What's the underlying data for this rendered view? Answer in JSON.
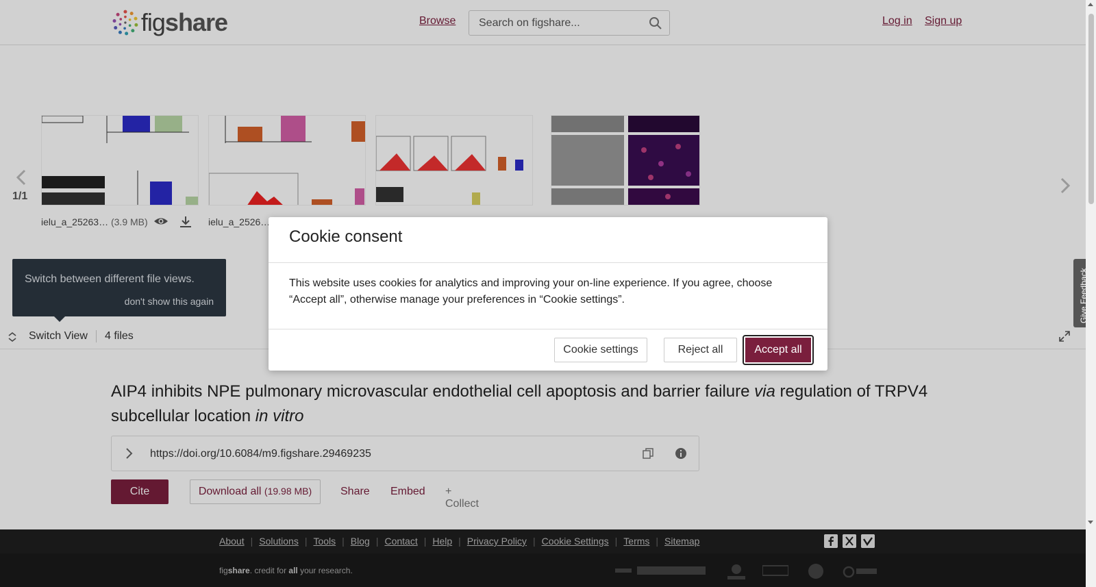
{
  "header": {
    "logo_light": "fig",
    "logo_bold": "share",
    "browse_label": "Browse",
    "search_placeholder": "Search on figshare...",
    "login_label": "Log in",
    "signup_label": "Sign up"
  },
  "viewer": {
    "page_counter": "1/1",
    "files": [
      {
        "name": "ielu_a_25263…",
        "size": "(3.9 MB)"
      },
      {
        "name": "ielu_a_2526…",
        "size": ""
      }
    ],
    "tooltip_text": "Switch between different file views.",
    "tooltip_dismiss": "don't show this again",
    "switch_view_label": "Switch View",
    "files_count": "4 files"
  },
  "article": {
    "title_part1": "AIP4 inhibits NPE pulmonary microvascular endothelial cell apoptosis and barrier failure ",
    "title_italic1": "via",
    "title_part2": " regulation of TRPV4 subcellular location ",
    "title_italic2": "in vitro",
    "doi": "https://doi.org/10.6084/m9.figshare.29469235",
    "cite_label": "Cite",
    "download_label": "Download all",
    "download_size": "(19.98 MB)",
    "share_label": "Share",
    "embed_label": "Embed",
    "collect_label": "+ Collect"
  },
  "cookie_modal": {
    "title": "Cookie consent",
    "body": "This website uses cookies for analytics and improving your on-line experience. If you agree, choose “Accept all”, otherwise manage your preferences in “Cookie settings”.",
    "settings_label": "Cookie settings",
    "reject_label": "Reject all",
    "accept_label": "Accept all"
  },
  "feedback_label": "Give Feedback",
  "footer": {
    "links": [
      "About",
      "Solutions",
      "Tools",
      "Blog",
      "Contact",
      "Help",
      "Privacy Policy",
      "Cookie Settings",
      "Terms",
      "Sitemap"
    ],
    "credit_pre": "fig",
    "credit_bold": "share",
    "credit_mid": ". credit for ",
    "credit_all": "all",
    "credit_post": " your research.",
    "social_icons": [
      "facebook-icon",
      "x-icon",
      "vimeo-icon"
    ]
  },
  "colors": {
    "brand": "#7a1f3d",
    "tooltip_bg": "#2d3743",
    "footer_bg": "#1f1f1f"
  }
}
